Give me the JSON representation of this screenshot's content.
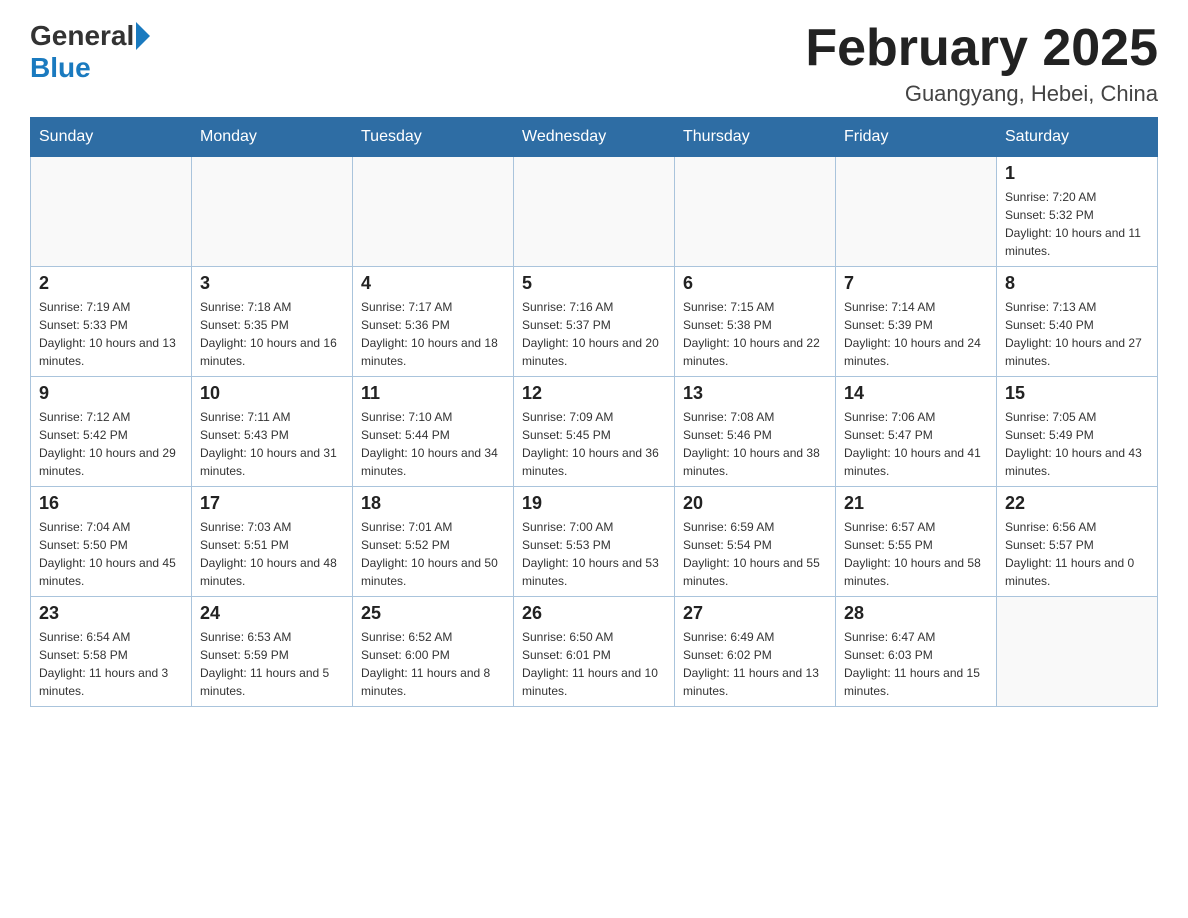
{
  "header": {
    "logo_general": "General",
    "logo_blue": "Blue",
    "main_title": "February 2025",
    "subtitle": "Guangyang, Hebei, China"
  },
  "days_of_week": [
    "Sunday",
    "Monday",
    "Tuesday",
    "Wednesday",
    "Thursday",
    "Friday",
    "Saturday"
  ],
  "weeks": [
    {
      "days": [
        {
          "number": "",
          "info": "",
          "empty": true
        },
        {
          "number": "",
          "info": "",
          "empty": true
        },
        {
          "number": "",
          "info": "",
          "empty": true
        },
        {
          "number": "",
          "info": "",
          "empty": true
        },
        {
          "number": "",
          "info": "",
          "empty": true
        },
        {
          "number": "",
          "info": "",
          "empty": true
        },
        {
          "number": "1",
          "info": "Sunrise: 7:20 AM\nSunset: 5:32 PM\nDaylight: 10 hours and 11 minutes.",
          "empty": false
        }
      ]
    },
    {
      "days": [
        {
          "number": "2",
          "info": "Sunrise: 7:19 AM\nSunset: 5:33 PM\nDaylight: 10 hours and 13 minutes.",
          "empty": false
        },
        {
          "number": "3",
          "info": "Sunrise: 7:18 AM\nSunset: 5:35 PM\nDaylight: 10 hours and 16 minutes.",
          "empty": false
        },
        {
          "number": "4",
          "info": "Sunrise: 7:17 AM\nSunset: 5:36 PM\nDaylight: 10 hours and 18 minutes.",
          "empty": false
        },
        {
          "number": "5",
          "info": "Sunrise: 7:16 AM\nSunset: 5:37 PM\nDaylight: 10 hours and 20 minutes.",
          "empty": false
        },
        {
          "number": "6",
          "info": "Sunrise: 7:15 AM\nSunset: 5:38 PM\nDaylight: 10 hours and 22 minutes.",
          "empty": false
        },
        {
          "number": "7",
          "info": "Sunrise: 7:14 AM\nSunset: 5:39 PM\nDaylight: 10 hours and 24 minutes.",
          "empty": false
        },
        {
          "number": "8",
          "info": "Sunrise: 7:13 AM\nSunset: 5:40 PM\nDaylight: 10 hours and 27 minutes.",
          "empty": false
        }
      ]
    },
    {
      "days": [
        {
          "number": "9",
          "info": "Sunrise: 7:12 AM\nSunset: 5:42 PM\nDaylight: 10 hours and 29 minutes.",
          "empty": false
        },
        {
          "number": "10",
          "info": "Sunrise: 7:11 AM\nSunset: 5:43 PM\nDaylight: 10 hours and 31 minutes.",
          "empty": false
        },
        {
          "number": "11",
          "info": "Sunrise: 7:10 AM\nSunset: 5:44 PM\nDaylight: 10 hours and 34 minutes.",
          "empty": false
        },
        {
          "number": "12",
          "info": "Sunrise: 7:09 AM\nSunset: 5:45 PM\nDaylight: 10 hours and 36 minutes.",
          "empty": false
        },
        {
          "number": "13",
          "info": "Sunrise: 7:08 AM\nSunset: 5:46 PM\nDaylight: 10 hours and 38 minutes.",
          "empty": false
        },
        {
          "number": "14",
          "info": "Sunrise: 7:06 AM\nSunset: 5:47 PM\nDaylight: 10 hours and 41 minutes.",
          "empty": false
        },
        {
          "number": "15",
          "info": "Sunrise: 7:05 AM\nSunset: 5:49 PM\nDaylight: 10 hours and 43 minutes.",
          "empty": false
        }
      ]
    },
    {
      "days": [
        {
          "number": "16",
          "info": "Sunrise: 7:04 AM\nSunset: 5:50 PM\nDaylight: 10 hours and 45 minutes.",
          "empty": false
        },
        {
          "number": "17",
          "info": "Sunrise: 7:03 AM\nSunset: 5:51 PM\nDaylight: 10 hours and 48 minutes.",
          "empty": false
        },
        {
          "number": "18",
          "info": "Sunrise: 7:01 AM\nSunset: 5:52 PM\nDaylight: 10 hours and 50 minutes.",
          "empty": false
        },
        {
          "number": "19",
          "info": "Sunrise: 7:00 AM\nSunset: 5:53 PM\nDaylight: 10 hours and 53 minutes.",
          "empty": false
        },
        {
          "number": "20",
          "info": "Sunrise: 6:59 AM\nSunset: 5:54 PM\nDaylight: 10 hours and 55 minutes.",
          "empty": false
        },
        {
          "number": "21",
          "info": "Sunrise: 6:57 AM\nSunset: 5:55 PM\nDaylight: 10 hours and 58 minutes.",
          "empty": false
        },
        {
          "number": "22",
          "info": "Sunrise: 6:56 AM\nSunset: 5:57 PM\nDaylight: 11 hours and 0 minutes.",
          "empty": false
        }
      ]
    },
    {
      "days": [
        {
          "number": "23",
          "info": "Sunrise: 6:54 AM\nSunset: 5:58 PM\nDaylight: 11 hours and 3 minutes.",
          "empty": false
        },
        {
          "number": "24",
          "info": "Sunrise: 6:53 AM\nSunset: 5:59 PM\nDaylight: 11 hours and 5 minutes.",
          "empty": false
        },
        {
          "number": "25",
          "info": "Sunrise: 6:52 AM\nSunset: 6:00 PM\nDaylight: 11 hours and 8 minutes.",
          "empty": false
        },
        {
          "number": "26",
          "info": "Sunrise: 6:50 AM\nSunset: 6:01 PM\nDaylight: 11 hours and 10 minutes.",
          "empty": false
        },
        {
          "number": "27",
          "info": "Sunrise: 6:49 AM\nSunset: 6:02 PM\nDaylight: 11 hours and 13 minutes.",
          "empty": false
        },
        {
          "number": "28",
          "info": "Sunrise: 6:47 AM\nSunset: 6:03 PM\nDaylight: 11 hours and 15 minutes.",
          "empty": false
        },
        {
          "number": "",
          "info": "",
          "empty": true
        }
      ]
    }
  ]
}
